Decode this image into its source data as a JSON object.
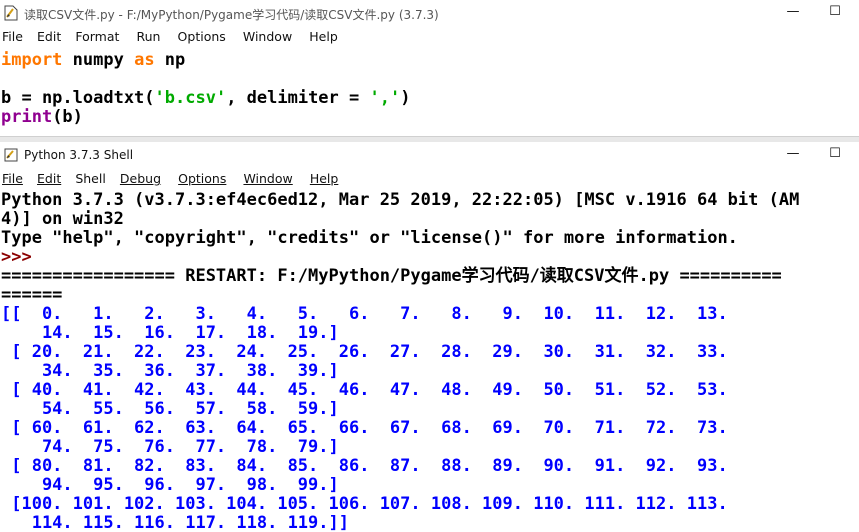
{
  "editor": {
    "title": "读取CSV文件.py - F:/MyPython/Pygame学习代码/读取CSV文件.py (3.7.3)",
    "menu": [
      "File",
      "Edit",
      "Format",
      "Run",
      "Options",
      "Window",
      "Help"
    ],
    "code": {
      "line1": {
        "kw_import": "import",
        "mod": " numpy ",
        "kw_as": "as",
        "alias": " np"
      },
      "line3": {
        "pre": "b = np.loadtxt(",
        "str1": "'b.csv'",
        "mid": ", delimiter = ",
        "str2": "','",
        "post": ")"
      },
      "line4": {
        "fn": "print",
        "args": "(b)"
      }
    }
  },
  "shell": {
    "title": "Python 3.7.3 Shell",
    "menu": [
      "File",
      "Edit",
      "Shell",
      "Debug",
      "Options",
      "Window",
      "Help"
    ],
    "banner": [
      "Python 3.7.3 (v3.7.3:ef4ec6ed12, Mar 25 2019, 22:22:05) [MSC v.1916 64 bit (AM",
      "4)] on win32",
      "Type \"help\", \"copyright\", \"credits\" or \"license()\" for more information."
    ],
    "prompt": ">>> ",
    "restart": [
      "================= RESTART: F:/MyPython/Pygame学习代码/读取CSV文件.py ==========",
      "======"
    ],
    "output": [
      "[[  0.   1.   2.   3.   4.   5.   6.   7.   8.   9.  10.  11.  12.  13.",
      "    14.  15.  16.  17.  18.  19.]",
      " [ 20.  21.  22.  23.  24.  25.  26.  27.  28.  29.  30.  31.  32.  33.",
      "    34.  35.  36.  37.  38.  39.]",
      " [ 40.  41.  42.  43.  44.  45.  46.  47.  48.  49.  50.  51.  52.  53.",
      "    54.  55.  56.  57.  58.  59.]",
      " [ 60.  61.  62.  63.  64.  65.  66.  67.  68.  69.  70.  71.  72.  73.",
      "    74.  75.  76.  77.  78.  79.]",
      " [ 80.  81.  82.  83.  84.  85.  86.  87.  88.  89.  90.  91.  92.  93.",
      "    94.  95.  96.  97.  98.  99.]",
      " [100. 101. 102. 103. 104. 105. 106. 107. 108. 109. 110. 111. 112. 113.",
      "   114. 115. 116. 117. 118. 119.]]"
    ]
  },
  "colors": {
    "keyword": "#ff7700",
    "builtin": "#900090",
    "string": "#00aa00",
    "output": "#0000ff",
    "prompt": "#8b0000"
  },
  "icons": {
    "editor": "python-file-icon",
    "shell": "python-shell-icon"
  }
}
